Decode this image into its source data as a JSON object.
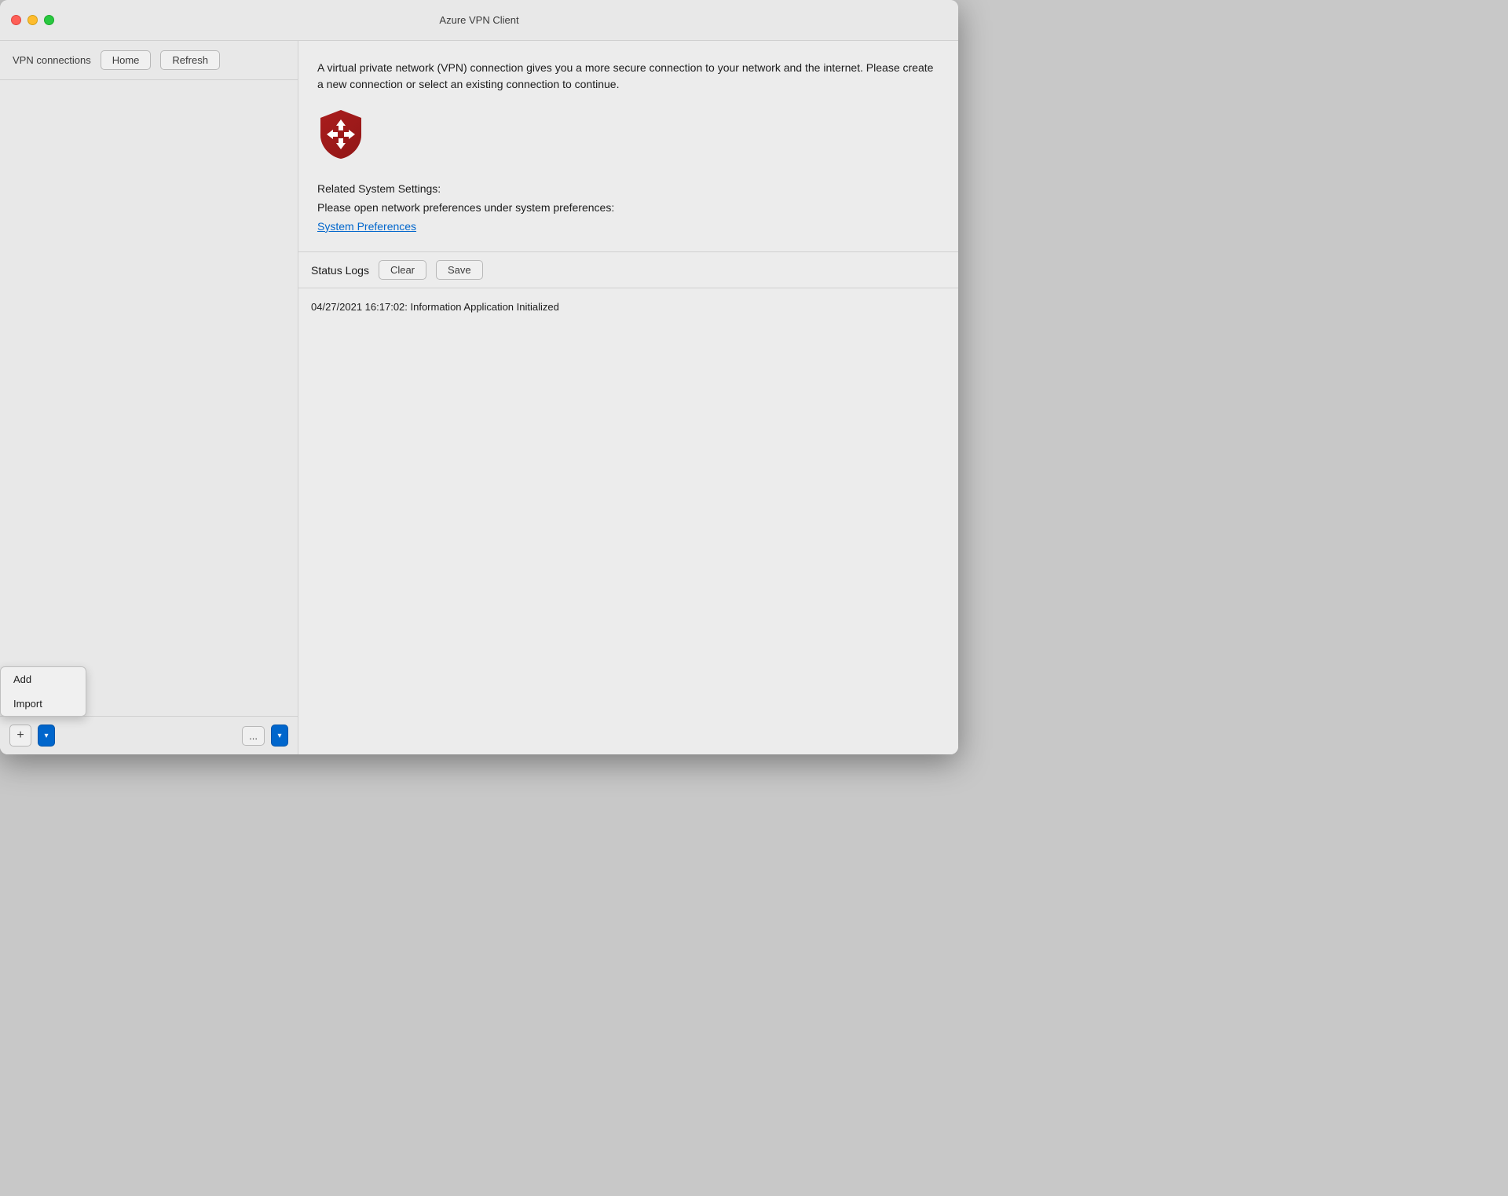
{
  "window": {
    "title": "Azure VPN Client"
  },
  "sidebar": {
    "title": "VPN connections",
    "home_button": "Home",
    "refresh_button": "Refresh",
    "add_button": "+",
    "more_button": "...",
    "dropdown_arrow": "▾",
    "context_menu": {
      "visible": true,
      "items": [
        "Add",
        "Import"
      ]
    }
  },
  "main": {
    "description": "A virtual private network (VPN) connection gives you a more secure connection to your network and the internet. Please create a new connection or select an existing connection to continue.",
    "related_settings": {
      "title": "Related System Settings:",
      "subtitle": "Please open network preferences under system preferences:",
      "link": "System Preferences"
    }
  },
  "logs": {
    "title": "Status Logs",
    "clear_button": "Clear",
    "save_button": "Save",
    "entries": [
      "04/27/2021 16:17:02: Information Application Initialized"
    ]
  },
  "icons": {
    "shield": "vpn-shield-icon",
    "chevron_down": "▾"
  }
}
